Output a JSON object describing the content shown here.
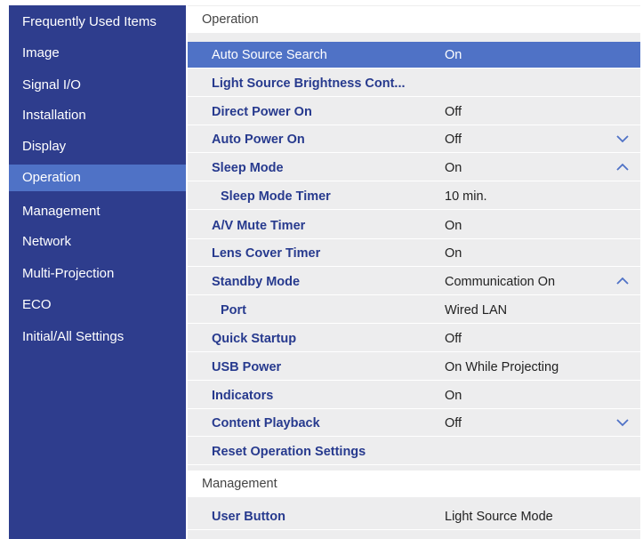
{
  "sidebar": {
    "items": [
      {
        "label": "Frequently Used Items",
        "active": false
      },
      {
        "label": "Image",
        "active": false
      },
      {
        "label": "Signal I/O",
        "active": false
      },
      {
        "label": "Installation",
        "active": false
      },
      {
        "label": "Display",
        "active": false
      },
      {
        "label": "Operation",
        "active": true
      },
      {
        "label": "Management",
        "active": false
      },
      {
        "label": "Network",
        "active": false
      },
      {
        "label": "Multi-Projection",
        "active": false
      },
      {
        "label": "ECO",
        "active": false
      },
      {
        "label": "Initial/All Settings",
        "active": false
      }
    ]
  },
  "content": {
    "section_operation": "Operation",
    "rows": [
      {
        "label": "Auto Source Search",
        "value": "On",
        "selected": true,
        "icon": ""
      },
      {
        "label": "Light Source Brightness Cont...",
        "value": "",
        "icon": ""
      },
      {
        "label": "Direct Power On",
        "value": "Off",
        "icon": ""
      },
      {
        "label": "Auto Power On",
        "value": "Off",
        "icon": "chevron-down-icon"
      },
      {
        "label": "Sleep Mode",
        "value": "On",
        "icon": "chevron-up-icon"
      },
      {
        "label": "Sleep Mode Timer",
        "value": "10 min.",
        "sub": true,
        "icon": ""
      },
      {
        "label": "A/V Mute Timer",
        "value": "On",
        "icon": ""
      },
      {
        "label": "Lens Cover Timer",
        "value": "On",
        "icon": ""
      },
      {
        "label": "Standby Mode",
        "value": "Communication On",
        "icon": "chevron-up-icon"
      },
      {
        "label": "Port",
        "value": "Wired LAN",
        "sub": true,
        "icon": ""
      },
      {
        "label": "Quick Startup",
        "value": "Off",
        "icon": ""
      },
      {
        "label": "USB Power",
        "value": "On While Projecting",
        "icon": ""
      },
      {
        "label": "Indicators",
        "value": "On",
        "icon": ""
      },
      {
        "label": "Content Playback",
        "value": "Off",
        "icon": "chevron-down-icon"
      },
      {
        "label": "Reset Operation Settings",
        "value": "",
        "icon": ""
      }
    ],
    "section_management": "Management",
    "management_rows": [
      {
        "label": "User Button",
        "value": "Light Source Mode"
      }
    ]
  },
  "colors": {
    "sidebar_bg": "#2e3d8d",
    "highlight": "#4f72c6",
    "label_text": "#273a8e",
    "panel_bg": "#ededee"
  }
}
